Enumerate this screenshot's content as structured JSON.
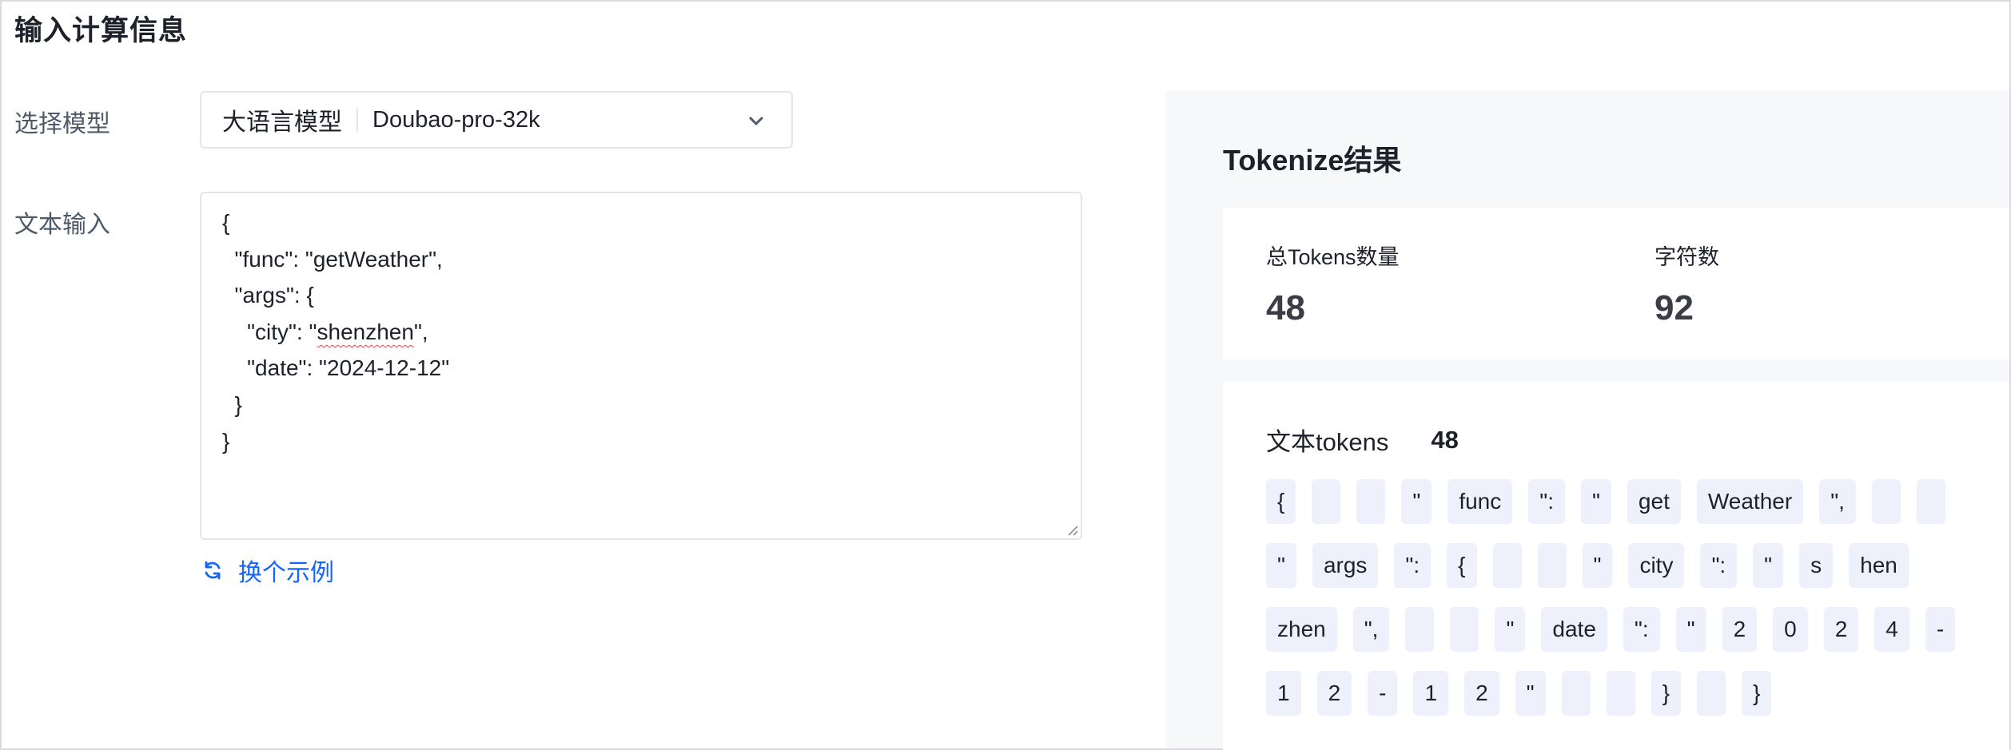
{
  "page_title": "输入计算信息",
  "form": {
    "model_label": "选择模型",
    "model_type": "大语言模型",
    "model_name": "Doubao-pro-32k",
    "text_label": "文本输入",
    "text_lines": [
      "{",
      "  \"func\": \"getWeather\",",
      "  \"args\": {",
      "    \"city\": \"",
      "shenzhen",
      "\",",
      "    \"date\": \"2024-12-12\"",
      "  }",
      "}"
    ],
    "swap_label": "换个示例"
  },
  "result": {
    "title": "Tokenize结果",
    "total_tokens_label": "总Tokens数量",
    "total_tokens_value": "48",
    "chars_label": "字符数",
    "chars_value": "92",
    "text_tokens_label": "文本tokens",
    "text_tokens_count": "48",
    "tokens": [
      "{",
      " ",
      " ",
      "\"",
      "func",
      "\":",
      "\"",
      "get",
      "Weather",
      "\",",
      " ",
      " ",
      "\"",
      "args",
      "\":",
      "{",
      " ",
      " ",
      "\"",
      "city",
      "\":",
      "\"",
      "s",
      "hen",
      "zhen",
      "\",",
      " ",
      " ",
      "\"",
      "date",
      "\":",
      "\"",
      "2",
      "0",
      "2",
      "4",
      "-",
      "1",
      "2",
      "-",
      "1",
      "2",
      "\"",
      " ",
      " ",
      "}",
      " ",
      "}"
    ]
  },
  "colors": {
    "accent": "#1664ff",
    "token_bg": "#eef1fc",
    "panel_bg": "#f7f8fa"
  },
  "icons": {
    "select": "chevron-down-icon",
    "swap": "refresh-icon",
    "resize": "resize-handle-icon"
  }
}
